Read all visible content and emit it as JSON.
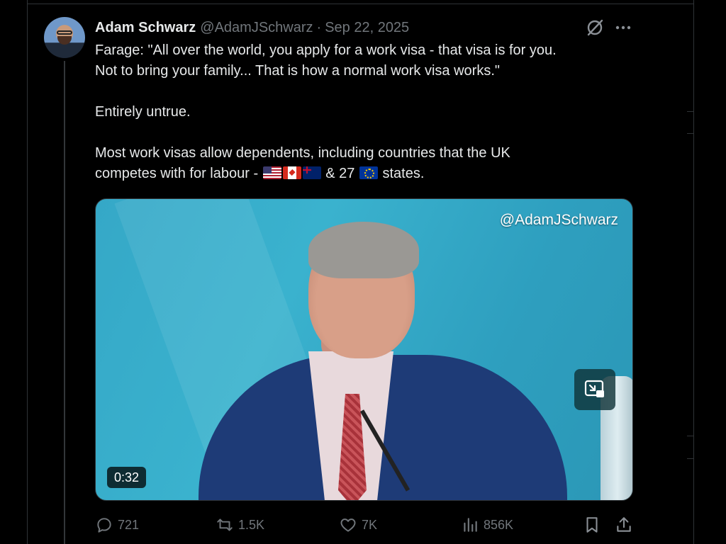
{
  "tweet": {
    "author_name": "Adam Schwarz",
    "handle": "@AdamJSchwarz",
    "separator": "·",
    "date": "Sep 22, 2025",
    "text_line1": "Farage: \"All over the world, you apply for a work visa - that visa is for you.",
    "text_line2": "Not to bring your family... That is how a normal work visa works.\"",
    "text_line3": "Entirely untrue.",
    "text_line4": "Most work visas allow dependents, including countries that the UK",
    "text_line5_prefix": "competes with for labour - ",
    "text_line5_mid": " & 27 ",
    "text_line5_suffix": " states."
  },
  "media": {
    "watermark": "@AdamJSchwarz",
    "duration": "0:32"
  },
  "actions": {
    "replies": "721",
    "reposts": "1.5K",
    "likes": "7K",
    "views": "856K"
  },
  "icons": {
    "avatar": "avatar",
    "grok": "grok-icon",
    "more": "more-icon",
    "reply": "reply-icon",
    "retweet": "retweet-icon",
    "like": "heart-icon",
    "views": "views-icon",
    "bookmark": "bookmark-icon",
    "share": "share-icon",
    "pip": "picture-in-picture-icon"
  },
  "colors": {
    "background": "#000000",
    "text": "#e7e9ea",
    "muted": "#71767b",
    "border": "#2f3336"
  }
}
